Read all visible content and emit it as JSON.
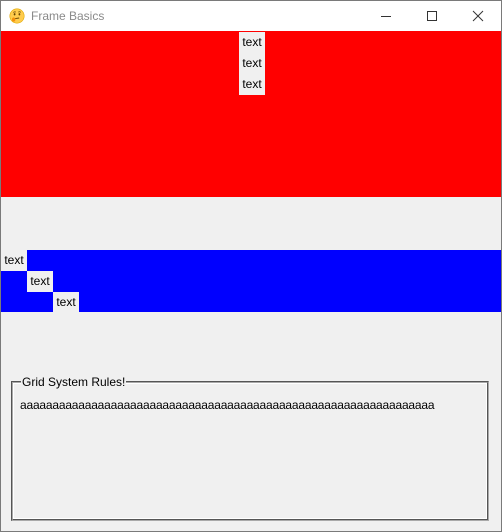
{
  "window": {
    "title": "Frame Basics",
    "app_icon": "thinking-face-emoji-icon",
    "controls": {
      "minimize_icon": "minimize-icon",
      "maximize_icon": "maximize-icon",
      "close_icon": "close-icon"
    }
  },
  "red_frame": {
    "color": "#ff0000",
    "labels": [
      "text",
      "text",
      "text"
    ]
  },
  "blue_frame": {
    "color": "#0000ff",
    "labels": [
      "text",
      "text",
      "text"
    ]
  },
  "labelframe": {
    "title": "Grid System Rules!",
    "content": "aaaaaaaaaaaaaaaaaaaaaaaaaaaaaaaaaaaaaaaaaaaaaaaaaaaaaaaaaaaaaaaa"
  }
}
